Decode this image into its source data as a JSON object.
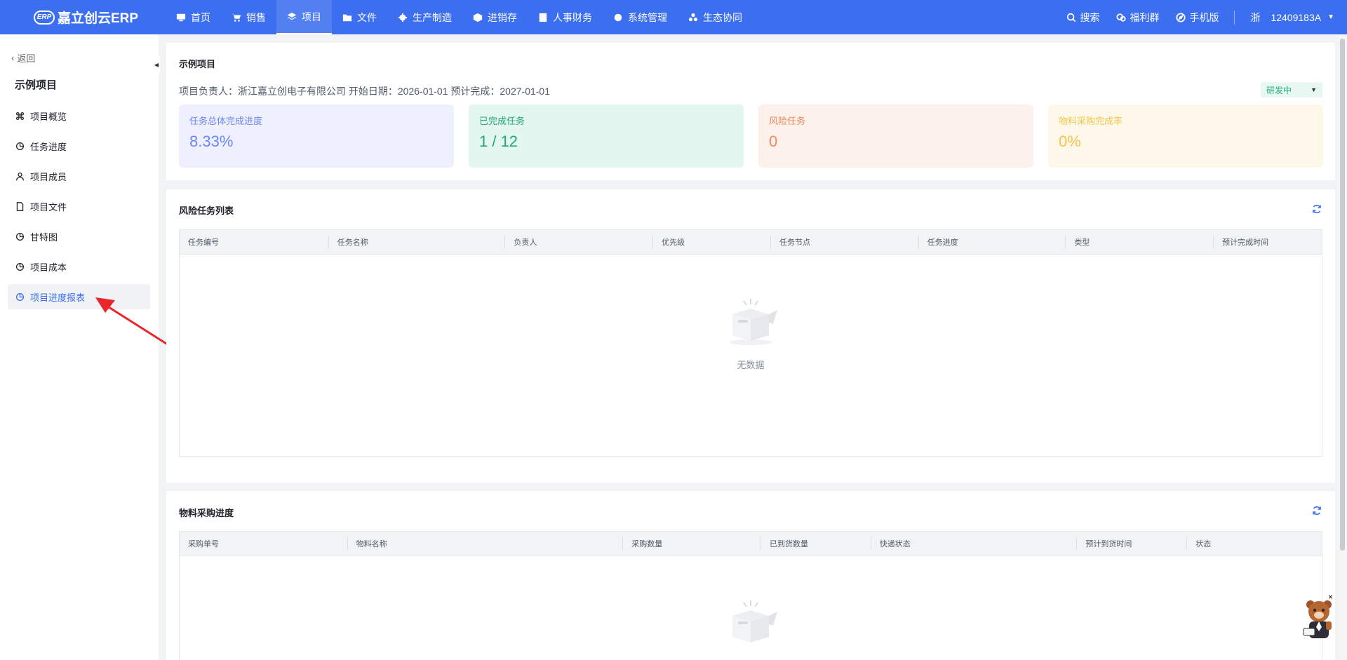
{
  "brand": {
    "name": "嘉立创云ERP",
    "badge": "ERP"
  },
  "nav": [
    {
      "label": "首页",
      "icon": "monitor-icon"
    },
    {
      "label": "销售",
      "icon": "cart-icon"
    },
    {
      "label": "项目",
      "icon": "layers-icon",
      "active": true
    },
    {
      "label": "文件",
      "icon": "folder-icon"
    },
    {
      "label": "生产制造",
      "icon": "gear-icon"
    },
    {
      "label": "进销存",
      "icon": "box-icon"
    },
    {
      "label": "人事财务",
      "icon": "finance-icon"
    },
    {
      "label": "系统管理",
      "icon": "settings-icon"
    },
    {
      "label": "生态协同",
      "icon": "cluster-icon"
    }
  ],
  "topRight": {
    "search": "搜索",
    "welfare": "福利群",
    "mobile": "手机版",
    "region": "浙",
    "account": "12409183A"
  },
  "sidebar": {
    "back": "返回",
    "project": "示例项目",
    "items": [
      {
        "label": "项目概览",
        "icon": "command-icon"
      },
      {
        "label": "任务进度",
        "icon": "pie-icon"
      },
      {
        "label": "项目成员",
        "icon": "user-icon"
      },
      {
        "label": "项目文件",
        "icon": "file-icon"
      },
      {
        "label": "甘特图",
        "icon": "pie-icon"
      },
      {
        "label": "项目成本",
        "icon": "pie-icon"
      },
      {
        "label": "项目进度报表",
        "icon": "pie-icon",
        "active": true
      }
    ]
  },
  "summary": {
    "title": "示例项目",
    "info": "项目负责人：浙江嘉立创电子有限公司   开始日期：2026-01-01   预计完成：2027-01-01",
    "status": "研发中",
    "stats": [
      {
        "label": "任务总体完成进度",
        "value": "8.33%",
        "bg": "#eef1fd",
        "color": "#6b86f0"
      },
      {
        "label": "已完成任务",
        "value": "1 / 12",
        "bg": "#e3f6f0",
        "color": "#21a67a"
      },
      {
        "label": "风险任务",
        "value": "0",
        "bg": "#fdf1ec",
        "color": "#f08a5d"
      },
      {
        "label": "物料采购完成率",
        "value": "0%",
        "bg": "#fdf8ea",
        "color": "#f3c64a"
      }
    ]
  },
  "riskTable": {
    "title": "风险任务列表",
    "columns": [
      "任务编号",
      "任务名称",
      "负责人",
      "优先级",
      "任务节点",
      "任务进度",
      "类型",
      "预计完成时间"
    ],
    "empty": "无数据"
  },
  "purchaseTable": {
    "title": "物料采购进度",
    "columns": [
      "采购单号",
      "物料名称",
      "采购数量",
      "已到货数量",
      "快递状态",
      "预计到货时间",
      "状态"
    ]
  },
  "mascot": {
    "close": "×"
  }
}
